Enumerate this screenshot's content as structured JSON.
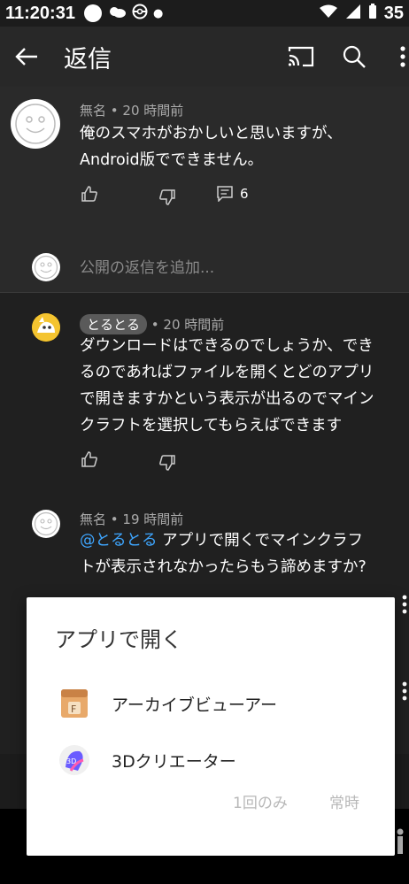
{
  "status": {
    "time": "11:20:31",
    "line_badge": "LINE",
    "battery_text": "35"
  },
  "appbar": {
    "title": "返信"
  },
  "parent_comment": {
    "author": "無名",
    "time": "20 時間前",
    "text_line1": "俺のスマホがおかしいと思いますが、",
    "text_line2": "Android版でできません。",
    "reply_count": "6"
  },
  "reply_input": {
    "placeholder": "公開の返信を追加..."
  },
  "replies": [
    {
      "author": "とるとる",
      "time": "20 時間前",
      "lines": [
        "ダウンロードはできるのでしょうか、でき",
        "るのであればファイルを開くとどのアプリ",
        "で開きますかという表示が出るのでマイン",
        "クラフトを選択してもらえばできます"
      ]
    },
    {
      "author": "無名",
      "time": "19 時間前",
      "mention": "@とるとる",
      "line1_rest": "アプリで開くでマインクラフ",
      "line2": "トが表示されなかったらもう諦めますか?"
    }
  ],
  "dialog": {
    "title": "アプリで開く",
    "apps": [
      {
        "label": "アーカイブビューアー",
        "icon": "archive-viewer-icon"
      },
      {
        "label": "3Dクリエーター",
        "icon": "3d-creator-icon"
      }
    ],
    "once_button": "1回のみ",
    "always_button": "常時"
  },
  "colors": {
    "mention": "#3ea6ff",
    "chip": "#5a5a5a",
    "background": "#202020"
  }
}
